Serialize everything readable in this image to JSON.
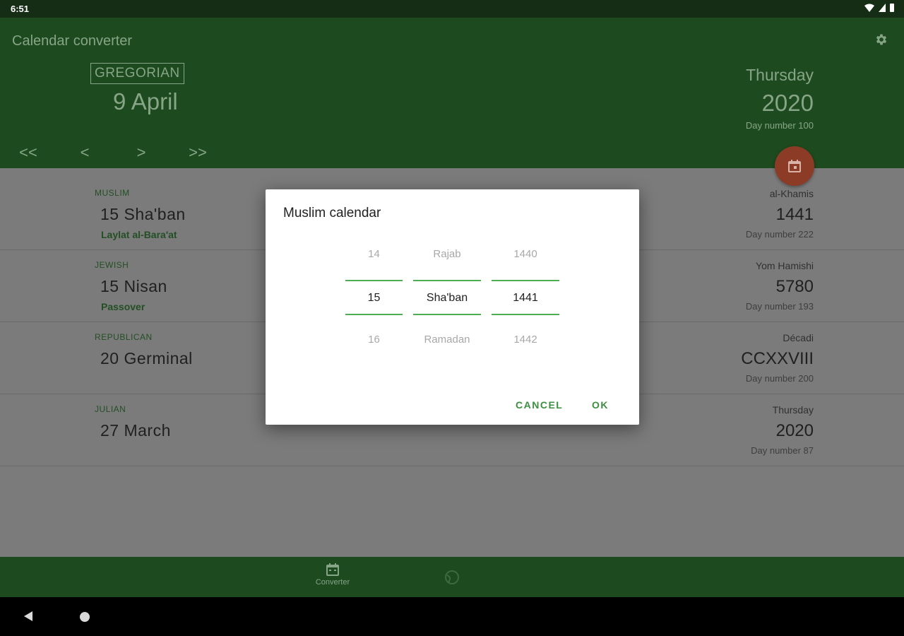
{
  "status": {
    "time": "6:51"
  },
  "header": {
    "title": "Calendar converter",
    "calendar_label": "GREGORIAN",
    "day_month": "9 April",
    "weekday": "Thursday",
    "year": "2020",
    "day_number": "Day number 100",
    "nav": {
      "first": "<<",
      "prev": "<",
      "next": ">",
      "last": ">>"
    }
  },
  "rows": [
    {
      "calendar": "MUSLIM",
      "date": "15 Sha'ban",
      "event": "Laylat al-Bara'at",
      "weekday": "al-Khamis",
      "year": "1441",
      "day_number": "Day number 222"
    },
    {
      "calendar": "JEWISH",
      "date": "15 Nisan",
      "event": "Passover",
      "weekday": "Yom Hamishi",
      "year": "5780",
      "day_number": "Day number 193"
    },
    {
      "calendar": "REPUBLICAN",
      "date": "20 Germinal",
      "event": "",
      "weekday": "Décadi",
      "year": "CCXXVIII",
      "day_number": "Day number 200"
    },
    {
      "calendar": "JULIAN",
      "date": "27 March",
      "event": "",
      "weekday": "Thursday",
      "year": "2020",
      "day_number": "Day number 87"
    }
  ],
  "dialog": {
    "title": "Muslim calendar",
    "day": {
      "prev": "14",
      "current": "15",
      "next": "16"
    },
    "month": {
      "prev": "Rajab",
      "current": "Sha'ban",
      "next": "Ramadan"
    },
    "year": {
      "prev": "1440",
      "current": "1441",
      "next": "1442"
    },
    "cancel": "CANCEL",
    "ok": "OK"
  },
  "bottom_nav": {
    "converter_label": "Converter"
  },
  "colors": {
    "primary": "#1d4a1e",
    "accent": "#4cae50",
    "fab": "#8b3b26"
  }
}
